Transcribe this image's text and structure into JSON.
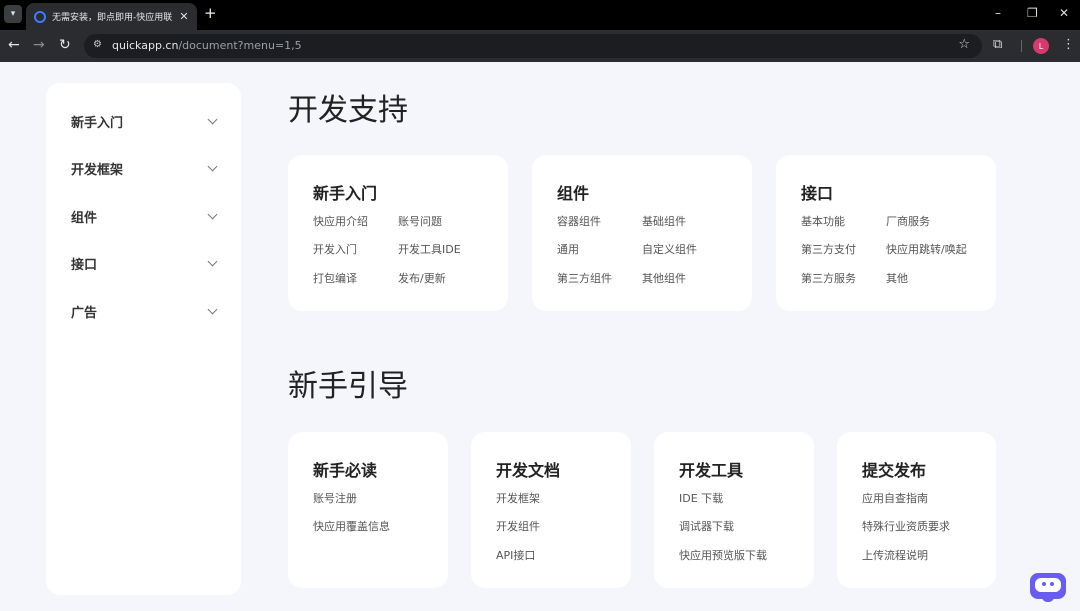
{
  "browser": {
    "tab_title": "无需安装，即点即用-快应用联",
    "new_tab_glyph": "+",
    "url_host": "quickapp.cn",
    "url_path": "/document?menu=1,5",
    "profile_initial": "L"
  },
  "sidebar": {
    "items": [
      {
        "label": "新手入门"
      },
      {
        "label": "开发框架"
      },
      {
        "label": "组件"
      },
      {
        "label": "接口"
      },
      {
        "label": "广告"
      }
    ]
  },
  "sections": [
    {
      "title": "开发支持",
      "cards": [
        {
          "title": "新手入门",
          "links": [
            "快应用介绍",
            "账号问题",
            "开发入门",
            "开发工具IDE",
            "打包编译",
            "发布/更新"
          ]
        },
        {
          "title": "组件",
          "links": [
            "容器组件",
            "基础组件",
            "通用",
            "自定义组件",
            "第三方组件",
            "其他组件"
          ]
        },
        {
          "title": "接口",
          "links": [
            "基本功能",
            "厂商服务",
            "第三方支付",
            "快应用跳转/唤起",
            "第三方服务",
            "其他"
          ]
        }
      ]
    },
    {
      "title": "新手引导",
      "cards": [
        {
          "title": "新手必读",
          "links": [
            "账号注册",
            "快应用覆盖信息"
          ]
        },
        {
          "title": "开发文档",
          "links": [
            "开发框架",
            "开发组件",
            "API接口"
          ]
        },
        {
          "title": "开发工具",
          "links": [
            "IDE 下载",
            "调试器下载",
            "快应用预览版下载"
          ]
        },
        {
          "title": "提交发布",
          "links": [
            "应用自查指南",
            "特殊行业资质要求",
            "上传流程说明"
          ]
        }
      ]
    }
  ],
  "icons": {
    "tab_menu": "chevron-down-icon",
    "favicon": "quickapp-logo-icon",
    "back": "arrow-left-icon",
    "forward": "arrow-right-icon",
    "reload": "reload-icon",
    "site_info": "tune-icon",
    "bookmark": "star-icon",
    "extensions": "puzzle-icon",
    "menu": "kebab-menu-icon",
    "assistant": "chatbot-icon"
  },
  "colors": {
    "page_bg": "#f4f6fb",
    "card_bg": "#ffffff",
    "assistant_accent": "#6b5cf0",
    "profile_avatar": "#d63a6c"
  }
}
